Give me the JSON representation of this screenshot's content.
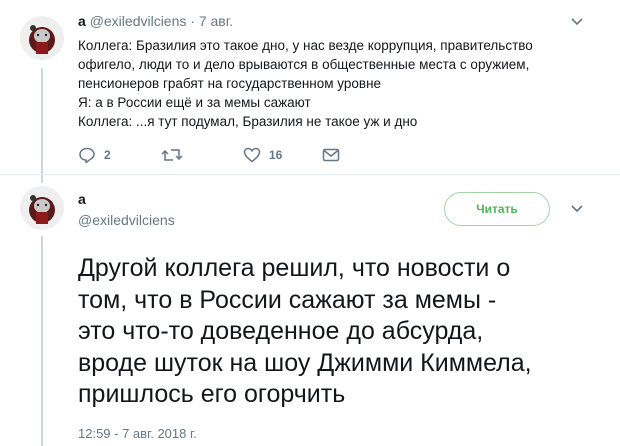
{
  "tweet1": {
    "name": "a",
    "handle": "@exiledvilciens",
    "separator": "·",
    "time": "7 авг.",
    "lines": [
      "Коллега: Бразилия это такое дно, у нас везде коррупция, правительство",
      "офигело, люди то и дело врываются в общественные места с оружием,",
      "пенсионеров грабят на государственном уровне",
      "Я: а в России ещё и за мемы сажают",
      "Коллега: ...я тут подумал, Бразилия не такое уж и дно"
    ],
    "actions": {
      "reply_icon": "reply-icon",
      "reply_count": "2",
      "retweet_icon": "retweet-icon",
      "retweet_count": "",
      "like_icon": "heart-icon",
      "like_count": "16",
      "dm_icon": "envelope-icon"
    }
  },
  "tweet2": {
    "name": "a",
    "handle": "@exiledvilciens",
    "read_button": "Читать",
    "lines": [
      "Другой коллега решил, что новости о",
      "том, что в России сажают за мемы -",
      "это что-то доведенное до абсурда,",
      "вроде шуток на шоу Джимми Киммела,",
      "пришлось его огорчить"
    ],
    "date": "12:59 - 7 авг. 2018 г."
  },
  "colors": {
    "text": "#14171a",
    "secondary": "#657786",
    "divider": "#e6ecf0",
    "read_button": "#4fb55a"
  }
}
